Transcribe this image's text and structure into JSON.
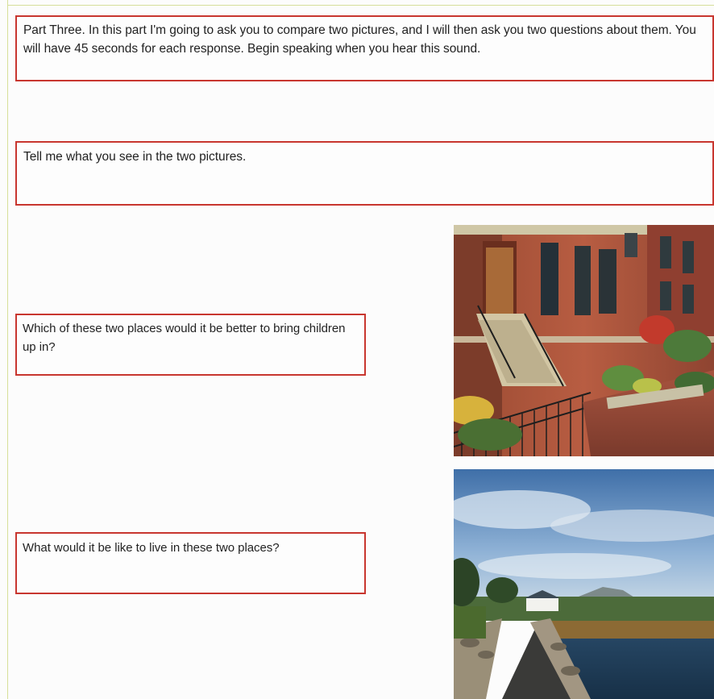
{
  "instructions": {
    "intro_text": "Part Three. In this part I'm going to ask you to compare two pictures, and I will then ask you two questions about them. You will have 45 seconds for each response. Begin speaking when you hear this sound."
  },
  "prompts": [
    {
      "text": "Tell me what you see in the two pictures."
    },
    {
      "text": "Which of these two places would it be better to bring children up in?"
    },
    {
      "text": "What would it be like to live in these two places?"
    }
  ],
  "colors": {
    "box_border": "#c8362f",
    "page_background": "#fcfcfc"
  },
  "photos": [
    {
      "icon": "townhouse-street-photo"
    },
    {
      "icon": "countryside-lake-photo"
    }
  ]
}
